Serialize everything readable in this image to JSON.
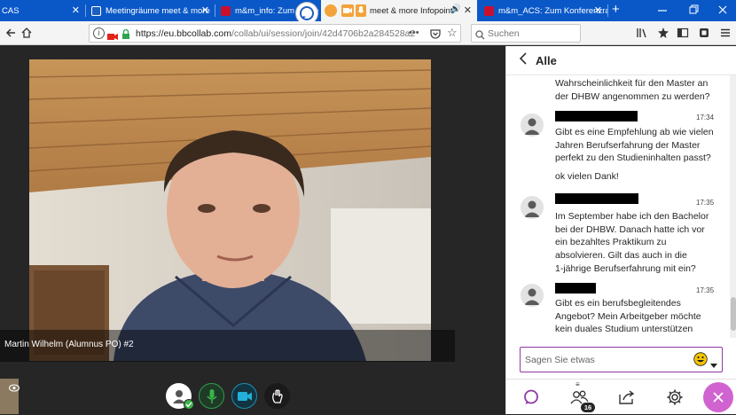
{
  "browser": {
    "tabs": [
      {
        "title": "CAS",
        "favicon_color": "#8a8a8a"
      },
      {
        "title": "Meetingräume meet & more",
        "favicon_color": "#1c5fbf"
      },
      {
        "title": "m&m_info: Zum Konferenz",
        "favicon_color": "#c8102e"
      },
      {
        "title": "meet & more Infopoint",
        "favicon_color": "#f3a33a"
      },
      {
        "title": "m&m_ACS: Zum Konferenzraum",
        "favicon_color": "#c8102e"
      }
    ],
    "new_tab_label": "+",
    "url_host": "https://eu.bbcollab.com",
    "url_path": "/collab/ui/session/join/42d4706b2a284528a2",
    "search_placeholder": "Suchen"
  },
  "video": {
    "participant_name": "Martin Wilhelm (Alumnus PO) #2"
  },
  "chat": {
    "header_title": "Alle",
    "messages": [
      {
        "lines": [
          "Wahrscheinlichkeit für den Master an",
          "der DHBW angenommen zu werden?"
        ]
      },
      {
        "time": "17:34",
        "lines": [
          "Gibt es eine Empfehlung ab wie vielen",
          "Jahren Berufserfahrung der Master",
          "perfekt zu den Studieninhalten passt?"
        ]
      },
      {
        "lines": [
          "ok vielen Dank!"
        ]
      },
      {
        "time": "17:35",
        "lines": [
          "Im September habe ich den Bachelor",
          "bei der DHBW. Danach hatte ich vor",
          "ein bezahltes Praktikum zu",
          "absolvieren. Gilt das auch in die",
          "1-jährige Berufserfahrung mit ein?"
        ]
      },
      {
        "time": "17:35",
        "lines": [
          "Gibt es ein berufsbegleitendes",
          "Angebot? Mein Arbeitgeber möchte",
          "kein duales Studium unterstützen"
        ]
      }
    ],
    "composer_placeholder": "Sagen Sie etwas",
    "participants_count": "16"
  },
  "colors": {
    "tabstrip": "#0a58c8",
    "accent_purple": "#8e3aa2",
    "mic_green": "#2e9e4f",
    "camera_teal": "#1b8fb0",
    "status_green": "#3ab449",
    "hangup_pink": "#d063cf"
  },
  "icons": [
    "back-arrow-icon",
    "forward-icon",
    "reload-icon",
    "home-icon",
    "info-icon",
    "camera-permission-icon",
    "lock-icon",
    "bookmarks-icon",
    "star-icon",
    "library-icon",
    "addon-icon",
    "sidebar-icon",
    "menu-icon",
    "chevron-left-icon",
    "smiley-icon",
    "caret-down-icon",
    "chat-icon",
    "participants-icon",
    "share-icon",
    "gear-icon",
    "close-icon",
    "mic-icon",
    "video-camera-icon",
    "hand-raise-icon",
    "user-avatar-icon",
    "eye-icon"
  ]
}
